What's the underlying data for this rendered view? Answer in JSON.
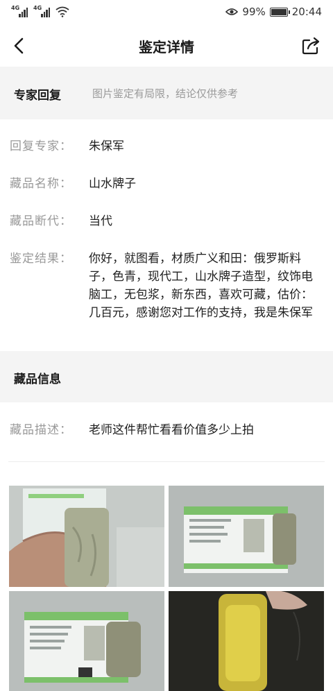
{
  "status_bar": {
    "network_1": "4G",
    "network_2": "4G",
    "battery": "99%",
    "battery_level": 0.99,
    "time": "20:44"
  },
  "nav": {
    "title": "鉴定详情",
    "back_icon": "chevron-left-icon",
    "share_icon": "share-icon"
  },
  "expert_section": {
    "heading": "专家回复",
    "note": "图片鉴定有局限，结论仅供参考"
  },
  "details": {
    "expert_label": "回复专家：",
    "expert_value": "朱保军",
    "name_label": "藏品名称：",
    "name_value": "山水牌子",
    "era_label": "藏品断代：",
    "era_value": "当代",
    "result_label": "鉴定结果：",
    "result_value": "你好，就图看，材质广义和田：俄罗斯料子，色青，现代工，山水牌子造型，纹饰电脑工，无包浆，新东西，喜欢可藏，估价：几百元，感谢您对工作的支持，我是朱保军"
  },
  "collection_section": {
    "heading": "藏品信息",
    "desc_label": "藏品描述：",
    "desc_value": "老师这件帮忙看看价值多少上拍"
  },
  "colors": {
    "section_bg": "#f4f4f4",
    "label": "#999999",
    "text": "#1f1f1f",
    "cert_green": "#7cc06a"
  }
}
